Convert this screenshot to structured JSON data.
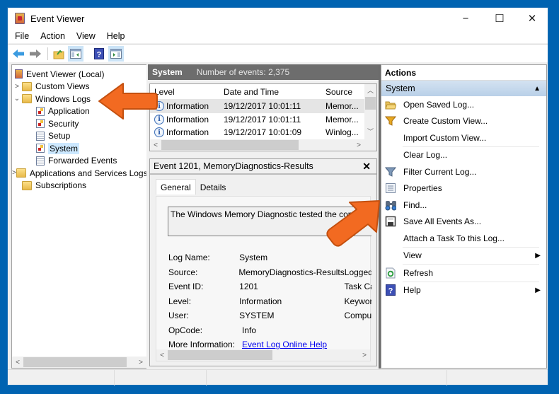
{
  "window": {
    "title": "Event Viewer",
    "controls": {
      "minimize": "−",
      "maximize": "☐",
      "close": "✕"
    }
  },
  "menu": [
    "File",
    "Action",
    "View",
    "Help"
  ],
  "toolbar": {
    "buttons": [
      "back-arrow-icon",
      "forward-arrow-icon",
      "up-folder-icon",
      "show-hide-console-tree-icon",
      "help-icon",
      "show-hide-action-pane-icon"
    ]
  },
  "tree": {
    "root": "Event Viewer (Local)",
    "items": [
      {
        "label": "Custom Views",
        "expanded": false
      },
      {
        "label": "Windows Logs",
        "expanded": true
      },
      {
        "label": "Application"
      },
      {
        "label": "Security"
      },
      {
        "label": "Setup"
      },
      {
        "label": "System",
        "selected": true
      },
      {
        "label": "Forwarded Events"
      },
      {
        "label": "Applications and Services Logs",
        "expanded": false
      },
      {
        "label": "Subscriptions"
      }
    ]
  },
  "events_pane": {
    "log_name": "System",
    "count_label": "Number of events: 2,375",
    "columns": [
      "Level",
      "Date and Time",
      "Source"
    ],
    "rows": [
      {
        "level": "Information",
        "date": "19/12/2017 10:01:11",
        "source": "Memor..."
      },
      {
        "level": "Information",
        "date": "19/12/2017 10:01:11",
        "source": "Memor..."
      },
      {
        "level": "Information",
        "date": "19/12/2017 10:01:09",
        "source": "Winlog..."
      }
    ]
  },
  "details": {
    "title": "Event 1201, MemoryDiagnostics-Results",
    "close": "✕",
    "tabs": [
      "General",
      "Details"
    ],
    "message": "The Windows Memory Diagnostic tested the computer's memory",
    "properties": [
      {
        "label": "Log Name:",
        "value": "System",
        "extra": ""
      },
      {
        "label": "Source:",
        "value": "MemoryDiagnostics-Results",
        "extra": "Logged:"
      },
      {
        "label": "Event ID:",
        "value": "1201",
        "extra": "Task Category:"
      },
      {
        "label": "Level:",
        "value": "Information",
        "extra": "Keywords:"
      },
      {
        "label": "User:",
        "value": "SYSTEM",
        "extra": "Computer:"
      },
      {
        "label": "OpCode:",
        "value": "Info",
        "extra": ""
      },
      {
        "label": "More Information:",
        "value": "Event Log Online Help",
        "extra": ""
      }
    ]
  },
  "actions": {
    "header": "Actions",
    "group": "System",
    "items": [
      {
        "label": "Open Saved Log...",
        "icon": "open-folder-icon"
      },
      {
        "label": "Create Custom View...",
        "icon": "filter-gold-icon"
      },
      {
        "label": "Import Custom View...",
        "icon": ""
      },
      {
        "label": "Clear Log...",
        "icon": ""
      },
      {
        "label": "Filter Current Log...",
        "icon": "filter-icon"
      },
      {
        "label": "Properties",
        "icon": "properties-icon"
      },
      {
        "label": "Find...",
        "icon": "binoculars-icon"
      },
      {
        "label": "Save All Events As...",
        "icon": "save-icon"
      },
      {
        "label": "Attach a Task To this Log...",
        "icon": ""
      },
      {
        "label": "View",
        "icon": "",
        "submenu": true
      },
      {
        "label": "Refresh",
        "icon": "refresh-icon"
      },
      {
        "label": "Help",
        "icon": "help-icon",
        "submenu": true
      }
    ]
  },
  "colors": {
    "desktop": "#0063b1",
    "highlight_arrow": "#f26a21",
    "pane_header": "#6d6d6d",
    "actions_group": "#c6d9ec",
    "link": "#0000ee"
  }
}
